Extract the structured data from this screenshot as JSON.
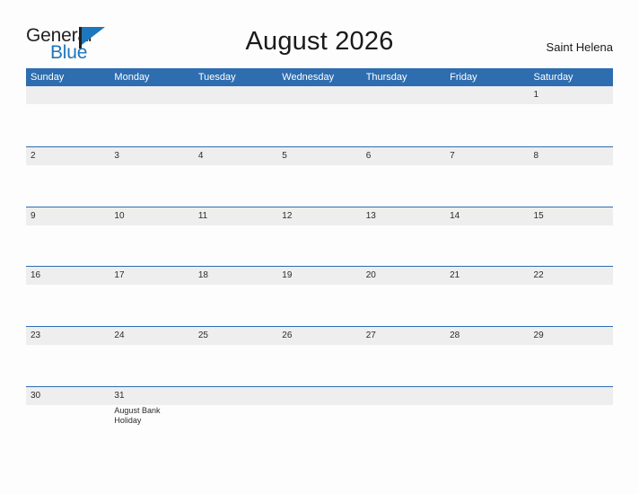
{
  "brand": {
    "name_top": "General",
    "name_bottom": "Blue",
    "top_color": "#231f20",
    "bottom_color": "#1e76bd",
    "flag_icon": "flag-triangle-icon"
  },
  "header": {
    "title": "August 2026",
    "region": "Saint Helena"
  },
  "theme": {
    "header_blue": "#2e6daf",
    "row_line_blue": "#2e6daf",
    "band_gray": "#eeeeee",
    "page_bg": "#fdfdfd",
    "text_dark": "#2b2b2b"
  },
  "calendar": {
    "weekdays": [
      "Sunday",
      "Monday",
      "Tuesday",
      "Wednesday",
      "Thursday",
      "Friday",
      "Saturday"
    ],
    "weeks": [
      [
        {
          "date": "",
          "events": []
        },
        {
          "date": "",
          "events": []
        },
        {
          "date": "",
          "events": []
        },
        {
          "date": "",
          "events": []
        },
        {
          "date": "",
          "events": []
        },
        {
          "date": "",
          "events": []
        },
        {
          "date": "1",
          "events": []
        }
      ],
      [
        {
          "date": "2",
          "events": []
        },
        {
          "date": "3",
          "events": []
        },
        {
          "date": "4",
          "events": []
        },
        {
          "date": "5",
          "events": []
        },
        {
          "date": "6",
          "events": []
        },
        {
          "date": "7",
          "events": []
        },
        {
          "date": "8",
          "events": []
        }
      ],
      [
        {
          "date": "9",
          "events": []
        },
        {
          "date": "10",
          "events": []
        },
        {
          "date": "11",
          "events": []
        },
        {
          "date": "12",
          "events": []
        },
        {
          "date": "13",
          "events": []
        },
        {
          "date": "14",
          "events": []
        },
        {
          "date": "15",
          "events": []
        }
      ],
      [
        {
          "date": "16",
          "events": []
        },
        {
          "date": "17",
          "events": []
        },
        {
          "date": "18",
          "events": []
        },
        {
          "date": "19",
          "events": []
        },
        {
          "date": "20",
          "events": []
        },
        {
          "date": "21",
          "events": []
        },
        {
          "date": "22",
          "events": []
        }
      ],
      [
        {
          "date": "23",
          "events": []
        },
        {
          "date": "24",
          "events": []
        },
        {
          "date": "25",
          "events": []
        },
        {
          "date": "26",
          "events": []
        },
        {
          "date": "27",
          "events": []
        },
        {
          "date": "28",
          "events": []
        },
        {
          "date": "29",
          "events": []
        }
      ],
      [
        {
          "date": "30",
          "events": []
        },
        {
          "date": "31",
          "events": [
            "August Bank Holiday"
          ]
        },
        {
          "date": "",
          "events": []
        },
        {
          "date": "",
          "events": []
        },
        {
          "date": "",
          "events": []
        },
        {
          "date": "",
          "events": []
        },
        {
          "date": "",
          "events": []
        }
      ]
    ]
  }
}
